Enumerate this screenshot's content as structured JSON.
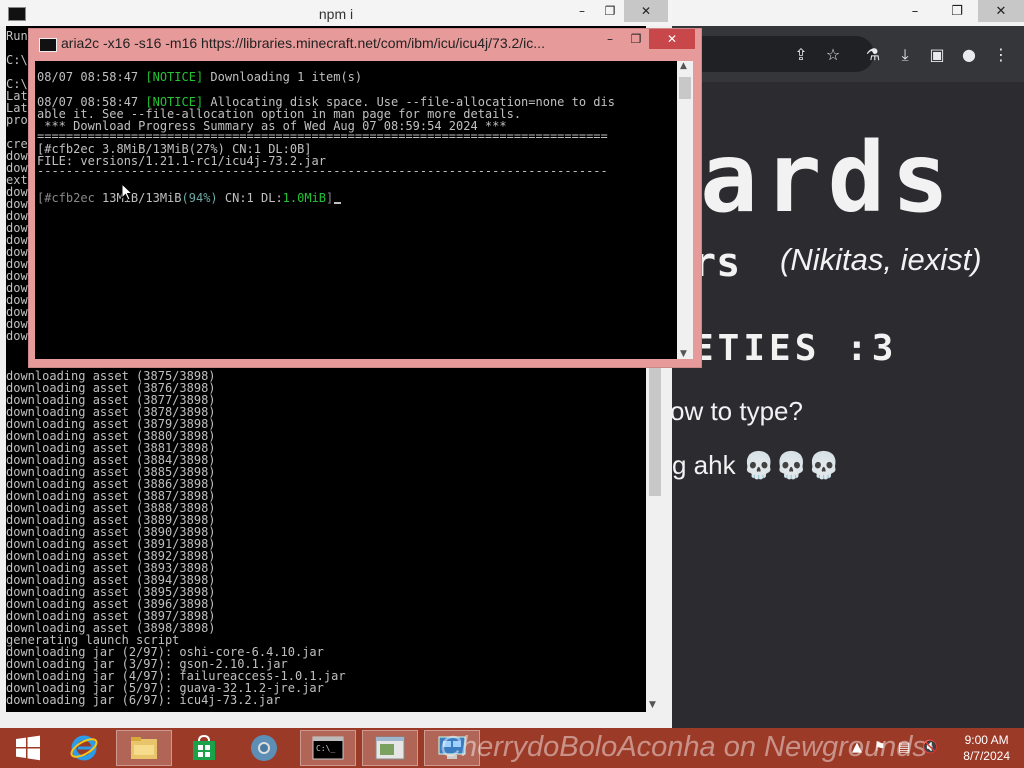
{
  "npm_window": {
    "title": "npm i",
    "left_stub_lines": [
      "Run",
      "",
      "C:\\",
      "",
      "C:\\",
      "Lat",
      "Lat",
      "pro",
      "",
      "cre",
      "dow",
      "dow",
      "ext",
      "dow",
      "dow",
      "dow",
      "dow",
      "dow",
      "dow",
      "dow",
      "dow",
      "dow",
      "dow",
      "dow",
      "dow",
      "dow"
    ],
    "lines": [
      "downloading asset (3875/3898)",
      "downloading asset (3876/3898)",
      "downloading asset (3877/3898)",
      "downloading asset (3878/3898)",
      "downloading asset (3879/3898)",
      "downloading asset (3880/3898)",
      "downloading asset (3881/3898)",
      "downloading asset (3884/3898)",
      "downloading asset (3885/3898)",
      "downloading asset (3886/3898)",
      "downloading asset (3887/3898)",
      "downloading asset (3888/3898)",
      "downloading asset (3889/3898)",
      "downloading asset (3890/3898)",
      "downloading asset (3891/3898)",
      "downloading asset (3892/3898)",
      "downloading asset (3893/3898)",
      "downloading asset (3894/3898)",
      "downloading asset (3895/3898)",
      "downloading asset (3896/3898)",
      "downloading asset (3897/3898)",
      "downloading asset (3898/3898)",
      "generating launch script",
      "downloading jar (2/97): oshi-core-6.4.10.jar",
      "downloading jar (3/97): gson-2.10.1.jar",
      "downloading jar (4/97): failureaccess-1.0.1.jar",
      "downloading jar (5/97): guava-32.1.2-jre.jar",
      "downloading jar (6/97): icu4j-73.2.jar"
    ]
  },
  "aria_window": {
    "title": "aria2c  -x16 -s16 -m16 https://libraries.minecraft.net/com/ibm/icu/icu4j/73.2/ic...",
    "l1_time": "08/07 08:58:47 ",
    "l1_tag": "[NOTICE]",
    "l1_text": " Downloading 1 item(s)",
    "l2_time": "08/07 08:58:47 ",
    "l2_tag": "[NOTICE]",
    "l2_text": " Allocating disk space. Use --file-allocation=none to dis",
    "l3_text": "able it. See --file-allocation option in man page for more details.",
    "l4_text": " *** Download Progress Summary as of Wed Aug 07 08:59:54 2024 ***",
    "rule_double": "===============================================================================",
    "l5_text": "[#cfb2ec 3.8MiB/13MiB(27%) CN:1 DL:0B]",
    "l6_text": "FILE: versions/1.21.1-rc1/icu4j-73.2.jar",
    "rule_single": "-------------------------------------------------------------------------------",
    "p_open": "[#cfb2ec ",
    "p_size": "13MiB/13MiB",
    "p_pct": "(94%)",
    "p_cn": " CN:1 DL:",
    "p_dl": "1.0MiB",
    "p_close": "]"
  },
  "page": {
    "big_title": "ards",
    "sub_pixel": "rs",
    "sub_italic": "(Nikitas, iexist)",
    "heading2": "ETIES  :3",
    "line3": "ow to type?",
    "line4": "g ahk 💀💀💀"
  },
  "taskbar": {
    "watermark": "CherrydoBoloAconha on Newgrounds",
    "time": "9:00 AM",
    "date": "8/7/2024"
  },
  "colors": {
    "taskbar": "#9c3a28",
    "aria_frame": "#e79a9a",
    "notice_green": "#22c232",
    "console_text": "#c0c0c0"
  }
}
